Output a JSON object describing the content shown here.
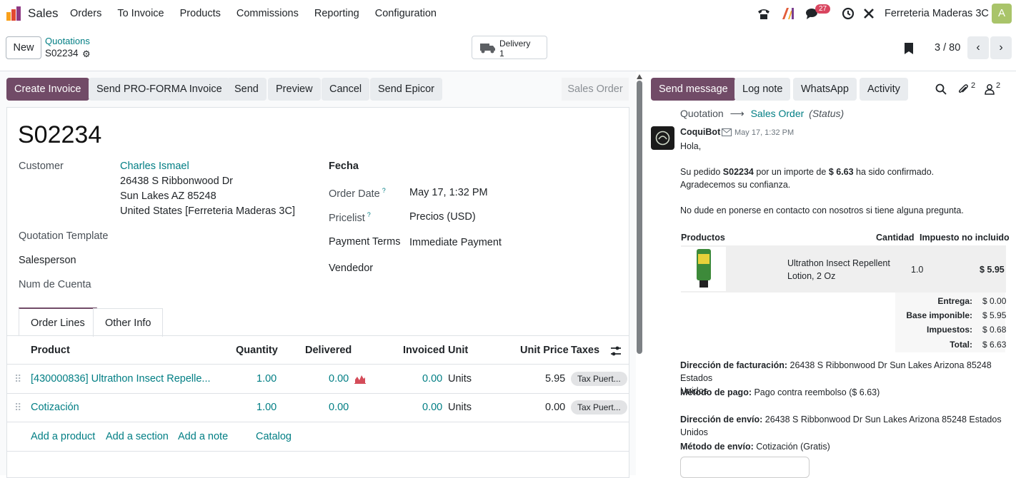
{
  "nav": {
    "brand": "Sales",
    "menu": [
      "Orders",
      "To Invoice",
      "Products",
      "Commissions",
      "Reporting",
      "Configuration"
    ],
    "messages_badge": "27",
    "company": "Ferreteria Maderas 3C",
    "avatar_letter": "A"
  },
  "control": {
    "new_label": "New",
    "breadcrumb_parent": "Quotations",
    "breadcrumb_current": "S02234",
    "delivery_label": "Delivery",
    "delivery_count": "1",
    "pager": "3 / 80"
  },
  "actions": {
    "create_invoice": "Create Invoice",
    "send_proforma": "Send PRO-FORMA Invoice",
    "send": "Send",
    "preview": "Preview",
    "cancel": "Cancel",
    "send_epicor": "Send Epicor",
    "status": "Sales Order"
  },
  "form": {
    "name": "S02234",
    "customer_label": "Customer",
    "customer_name": "Charles Ismael",
    "address_line1": "26438 S Ribbonwood Dr",
    "address_line2": "Sun Lakes AZ 85248",
    "address_line3": "United States [Ferreteria Maderas 3C]",
    "quotation_template_label": "Quotation Template",
    "salesperson_label": "Salesperson",
    "num_cuenta_label": "Num de Cuenta",
    "fecha_label": "Fecha",
    "order_date_label": "Order Date",
    "order_date": "May 17, 1:32 PM",
    "pricelist_label": "Pricelist",
    "pricelist": "Precios (USD)",
    "payment_terms_label": "Payment Terms",
    "payment_terms": "Immediate Payment",
    "vendedor_label": "Vendedor",
    "help_mark": "?"
  },
  "tabs": [
    "Order Lines",
    "Other Info"
  ],
  "table": {
    "headers": {
      "product": "Product",
      "quantity": "Quantity",
      "delivered": "Delivered",
      "invoiced": "Invoiced",
      "unit": "Unit",
      "unit_price": "Unit Price",
      "taxes": "Taxes"
    },
    "rows": [
      {
        "product": "[430000836] Ultrathon Insect Repelle...",
        "quantity": "1.00",
        "delivered": "0.00",
        "invoiced": "0.00",
        "unit": "Units",
        "unit_price": "5.95",
        "taxes": "Tax Puert..."
      },
      {
        "product": "Cotización",
        "quantity": "1.00",
        "delivered": "0.00",
        "invoiced": "0.00",
        "unit": "Units",
        "unit_price": "0.00",
        "taxes": "Tax Puert..."
      }
    ],
    "add_links": [
      "Add a product",
      "Add a section",
      "Add a note",
      "Catalog"
    ]
  },
  "chatter": {
    "send_message": "Send message",
    "log_note": "Log note",
    "whatsapp": "WhatsApp",
    "activity": "Activity",
    "attachments_count": "2",
    "followers_count": "2",
    "tracking_old": "Quotation",
    "tracking_new": "Sales Order",
    "tracking_field": "(Status)",
    "author": "CoquiBot",
    "date": "May 17, 1:32 PM",
    "greeting": "Hola,",
    "msg_line1_a": "Su pedido ",
    "msg_order": "S02234",
    "msg_line1_b": " por un importe de ",
    "msg_amount": "$ 6.63",
    "msg_line1_c": " ha sido confirmado.",
    "msg_line2": "Agradecemos su confianza.",
    "msg_line3": "No dude en ponerse en contacto con nosotros si tiene alguna pregunta.",
    "col_products": "Productos",
    "col_qty": "Cantidad",
    "col_tax": "Impuesto no incluido",
    "line_product": "Ultrathon Insect Repellent Lotion, 2 Oz",
    "line_product_1": "Ultrathon Insect Repellent",
    "line_product_2": "Lotion, 2 Oz",
    "line_qty": "1.0",
    "line_amount": "$ 5.95",
    "totals": [
      {
        "label": "Entrega:",
        "value": "$ 0.00"
      },
      {
        "label": "Base imponible:",
        "value": "$ 5.95"
      },
      {
        "label": "Impuestos:",
        "value": "$ 0.68"
      },
      {
        "label": "Total:",
        "value": "$ 6.63"
      }
    ],
    "billing_label": "Dirección de facturación:",
    "billing_value_1": " 26438 S Ribbonwood Dr Sun Lakes Arizona 85248 Estados",
    "billing_value_2": "Unidos",
    "payment_label": "Método de pago:",
    "payment_value": " Pago contra reembolso ($ 6.63)",
    "shipping_label": "Dirección de envío:",
    "shipping_value_1": " 26438 S Ribbonwood Dr Sun Lakes Arizona 85248 Estados",
    "shipping_value_2": "Unidos",
    "shipmethod_label": "Método de envío:",
    "shipmethod_value": " Cotización (Gratis)"
  },
  "colors": {
    "primary": "#714b67",
    "link": "#017e84",
    "badge": "#d9455f"
  }
}
